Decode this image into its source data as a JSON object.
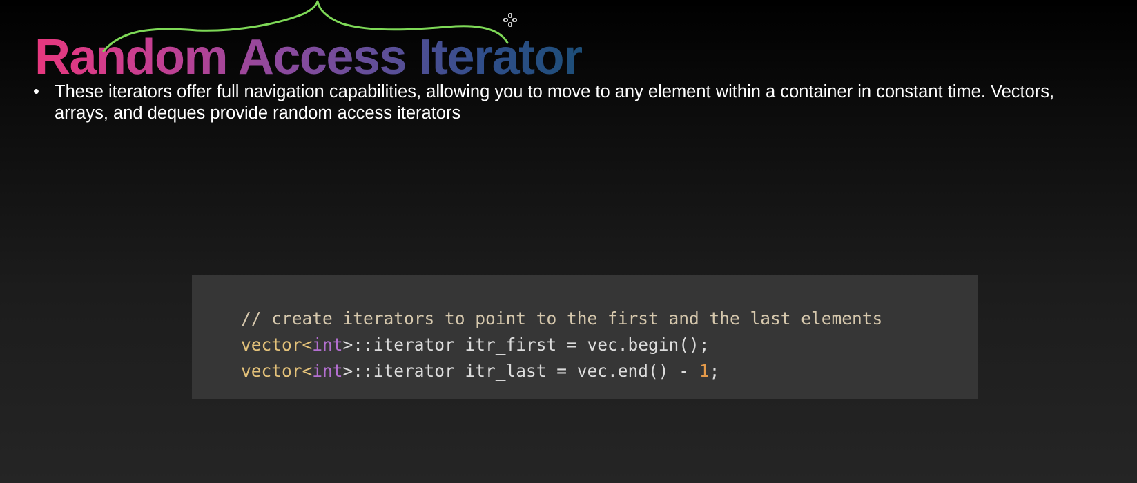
{
  "slide": {
    "title": "Random Access Iterator",
    "bullets": [
      "These iterators offer full navigation capabilities, allowing you to move to any element within a container in constant time. Vectors, arrays, and deques provide random access iterators"
    ],
    "bullet_symbol": "•"
  },
  "code": {
    "line1": {
      "comment": "// create iterators to point to the first and the last elements"
    },
    "line2": {
      "type": "vector",
      "open": "<",
      "keyword": "int",
      "rest": ">::iterator itr_first = vec.begin();"
    },
    "line3": {
      "type": "vector",
      "open": "<",
      "keyword": "int",
      "rest": ">::iterator itr_last = vec.end() - ",
      "number": "1",
      "end": ";"
    }
  },
  "colors": {
    "title_gradient": [
      "#e8387e",
      "#c43f92",
      "#8d4a9e",
      "#5b4f98",
      "#304e8a",
      "#1d4e78"
    ],
    "annotation_stroke": "#7ed957",
    "code_background": "#363636",
    "code_comment": "#d6c8ad",
    "code_type": "#e4c27a",
    "code_keyword": "#b36fd0",
    "code_number": "#e49a4a"
  },
  "icons": {
    "cursor": "crosshair-cursor-icon",
    "annotation": "hand-drawn-brace-annotation"
  }
}
